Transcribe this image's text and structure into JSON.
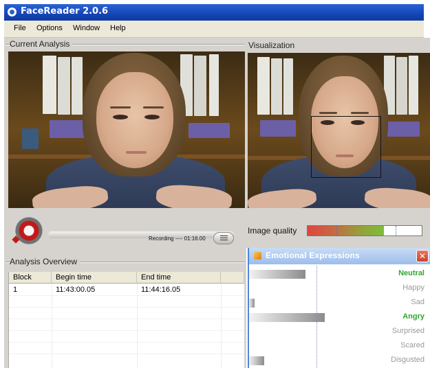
{
  "window": {
    "title": "FaceReader 2.0.6"
  },
  "menu": [
    "File",
    "Options",
    "Window",
    "Help"
  ],
  "panels": {
    "current_analysis": "Current Analysis",
    "visualization": "Visualization",
    "analysis_overview": "Analysis Overview"
  },
  "recording": {
    "status": "Recording ---- 01:16.00"
  },
  "table": {
    "columns": [
      "Block",
      "Begin time",
      "End time"
    ],
    "rows": [
      {
        "block": "1",
        "begin": "11:43:00.05",
        "end": "11:44:16.05"
      }
    ]
  },
  "image_quality": {
    "label": "Image quality",
    "level": 0.67
  },
  "emotional_expressions": {
    "title": "Emotional Expressions",
    "close_glyph": "✕",
    "items": [
      {
        "label": "Neutral",
        "value": 0.42,
        "active": true
      },
      {
        "label": "Happy",
        "value": 0.0,
        "active": false
      },
      {
        "label": "Sad",
        "value": 0.04,
        "active": false
      },
      {
        "label": "Angry",
        "value": 0.56,
        "active": true
      },
      {
        "label": "Surprised",
        "value": 0.0,
        "active": false
      },
      {
        "label": "Scared",
        "value": 0.0,
        "active": false
      },
      {
        "label": "Disgusted",
        "value": 0.11,
        "active": false
      }
    ]
  },
  "colors": {
    "active_label": "#2ea82e",
    "title_bar": "#1546b6",
    "record": "#c21a1a"
  },
  "icons": [
    "app-logo-icon",
    "record-icon",
    "list-icon",
    "emotion-window-icon",
    "close-icon"
  ]
}
